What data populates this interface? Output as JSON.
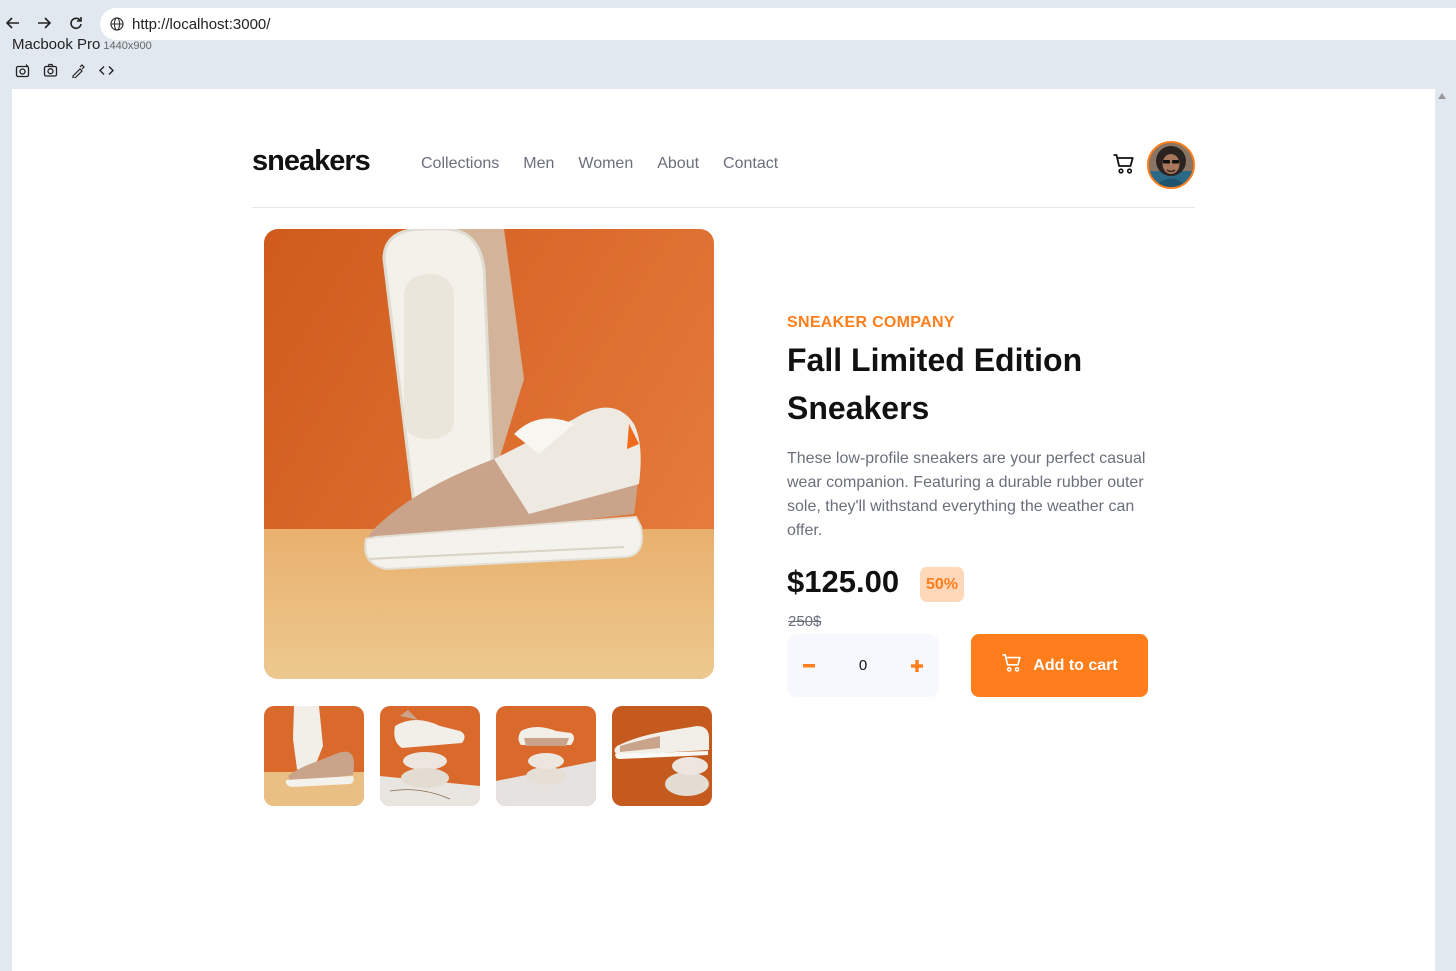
{
  "browser": {
    "url": "http://localhost:3000/",
    "device_name": "Macbook Pro",
    "device_size": "1440x900"
  },
  "header": {
    "logo": "sneakers",
    "nav": [
      "Collections",
      "Men",
      "Women",
      "About",
      "Contact"
    ]
  },
  "product": {
    "company": "SNEAKER COMPANY",
    "title": "Fall Limited Edition Sneakers",
    "description": "These low-profile sneakers are your perfect casual wear companion. Featuring a durable rubber outer sole, they'll withstand everything the weather can offer.",
    "price": "$125.00",
    "discount": "50%",
    "old_price": "250$",
    "quantity": "0",
    "add_to_cart_label": "Add to cart"
  },
  "colors": {
    "accent": "#ff7e1b",
    "badge_bg": "#ffd7b9",
    "text_dark": "#111111",
    "text_muted": "#6b6f7b"
  }
}
